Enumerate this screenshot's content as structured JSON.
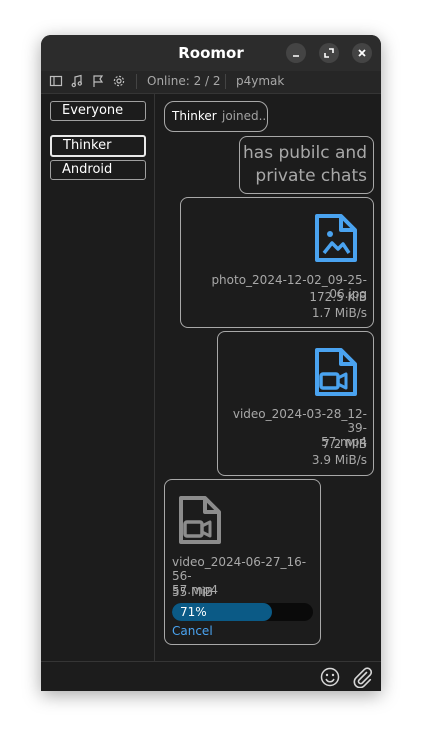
{
  "window": {
    "title": "Roomor"
  },
  "toolbar": {
    "online": "Online: 2 / 2",
    "username": "p4ymak"
  },
  "sidebar": {
    "items": [
      {
        "label": "Everyone"
      },
      {
        "label": "Thinker"
      },
      {
        "label": "Android"
      }
    ]
  },
  "messages": {
    "join": {
      "name": "Thinker",
      "text": "joined.."
    },
    "text_msg": {
      "line1": "has pubilc and",
      "line2": "private chats"
    },
    "photo": {
      "icon": "image-file-icon",
      "filename": "photo_2024-12-02_09-25-06.jpg",
      "size": "172.5 KiB",
      "speed": "1.7 MiB/s"
    },
    "video_sent": {
      "icon": "video-file-icon",
      "filename_line1": "video_2024-03-28_12-39-",
      "filename_line2": "57.mp4",
      "size": "7.2 MiB",
      "speed": "3.9 MiB/s"
    },
    "video_recv": {
      "icon": "video-file-icon",
      "filename_line1": "video_2024-06-27_16-56-",
      "filename_line2": "57.mp4",
      "size": "55 MiB",
      "progress_label": "71%",
      "progress": 0.71,
      "cancel": "Cancel"
    }
  },
  "bottombar": {
    "emoji_icon": "smiley-icon",
    "attach_icon": "paperclip-icon"
  },
  "colors": {
    "accent": "#4aa3f0",
    "progress": "#0b5a86",
    "background": "#1c1c1c"
  }
}
